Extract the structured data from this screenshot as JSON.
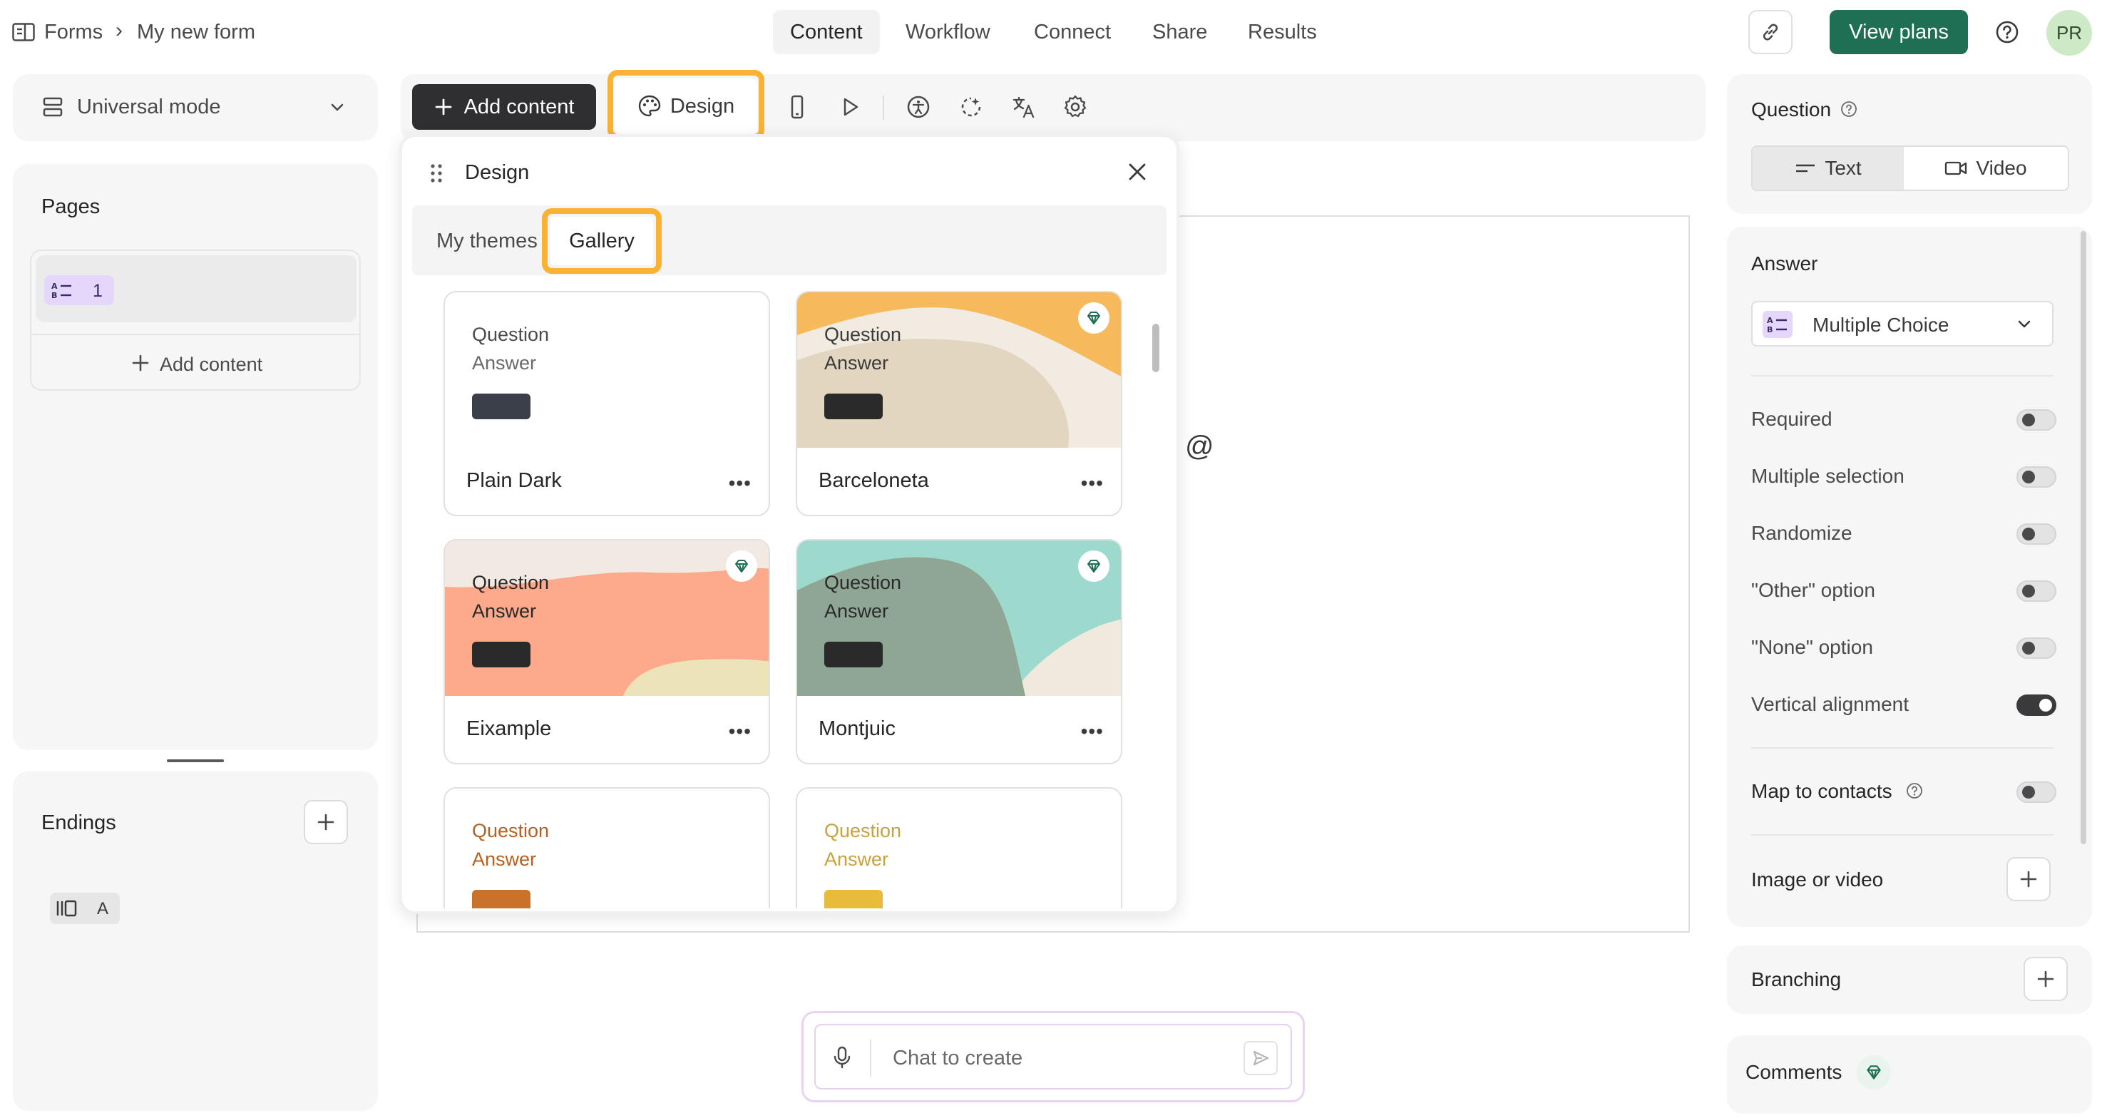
{
  "header": {
    "breadcrumb_root": "Forms",
    "breadcrumb_separator": "›",
    "form_name": "My new form",
    "tabs": [
      "Content",
      "Workflow",
      "Connect",
      "Share",
      "Results"
    ],
    "active_tab": "Content",
    "view_plans_label": "View plans",
    "avatar_initials": "PR"
  },
  "left": {
    "mode_label": "Universal mode",
    "pages_title": "Pages",
    "page_item_number": "1",
    "add_content_label": "Add content",
    "endings_title": "Endings",
    "ending_item_letter": "A"
  },
  "toolbar": {
    "add_content_label": "Add content",
    "design_label": "Design"
  },
  "design_panel": {
    "title": "Design",
    "tabs": [
      "My themes",
      "Gallery"
    ],
    "active_tab": "Gallery",
    "themes": [
      {
        "name": "Plain Dark",
        "question": "Question",
        "answer": "Answer",
        "premium": false,
        "text_color": "#4a4a4c",
        "button_color": "#3b3f4a"
      },
      {
        "name": "Barceloneta",
        "question": "Question",
        "answer": "Answer",
        "premium": true,
        "text_color": "#3b3b3b",
        "button_color": "#2a2a2a"
      },
      {
        "name": "Eixample",
        "question": "Question",
        "answer": "Answer",
        "premium": true,
        "text_color": "#2a2a2a",
        "button_color": "#2a2a2a"
      },
      {
        "name": "Montjuic",
        "question": "Question",
        "answer": "Answer",
        "premium": true,
        "text_color": "#2a2a2a",
        "button_color": "#2a2a2a"
      },
      {
        "name": "",
        "question": "Question",
        "answer": "Answer",
        "premium": false,
        "text_color": "#b7601f",
        "button_color": "#c8722a"
      },
      {
        "name": "",
        "question": "Question",
        "answer": "Answer",
        "premium": false,
        "text_color": "#c9a23a",
        "button_color": "#e8bb3a"
      }
    ]
  },
  "canvas": {
    "at_symbol": "@"
  },
  "chat": {
    "placeholder": "Chat to create"
  },
  "right": {
    "question_title": "Question",
    "question_types": [
      "Text",
      "Video"
    ],
    "answer_title": "Answer",
    "answer_type": "Multiple Choice",
    "toggles": [
      {
        "label": "Required",
        "on": false
      },
      {
        "label": "Multiple selection",
        "on": false
      },
      {
        "label": "Randomize",
        "on": false
      },
      {
        "label": "\"Other\" option",
        "on": false
      },
      {
        "label": "\"None\" option",
        "on": false
      },
      {
        "label": "Vertical alignment",
        "on": true
      }
    ],
    "map_to_contacts_label": "Map to contacts",
    "map_to_contacts_on": false,
    "image_or_video_label": "Image or video",
    "branching_label": "Branching",
    "comments_label": "Comments"
  },
  "colors": {
    "accent_green": "#1f6f54",
    "highlight_orange": "#f9b233",
    "avatar_bg": "#cde9c5"
  }
}
